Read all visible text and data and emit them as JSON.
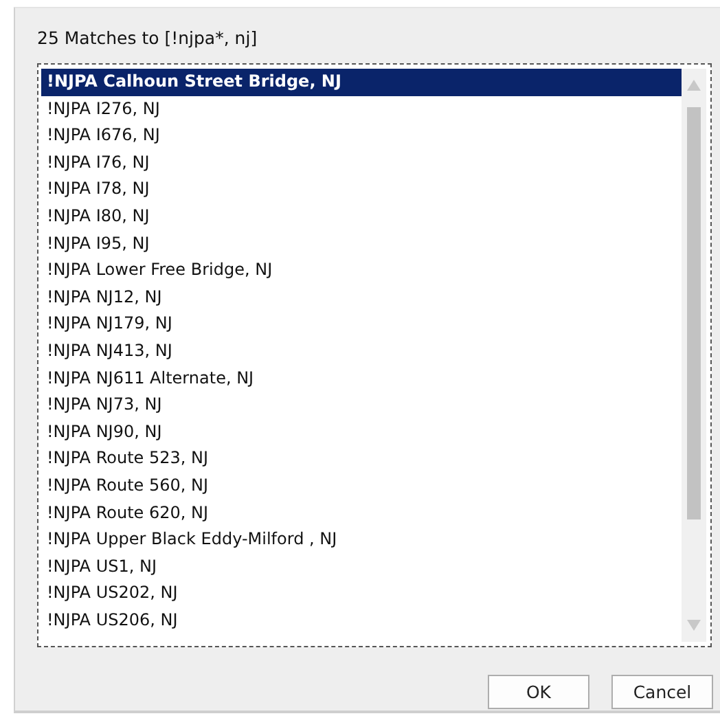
{
  "dialog": {
    "title": "25 Matches to [!njpa*, nj]"
  },
  "list": {
    "items": [
      {
        "label": "!NJPA Calhoun Street Bridge, NJ",
        "selected": true
      },
      {
        "label": "!NJPA I276, NJ",
        "selected": false
      },
      {
        "label": "!NJPA I676, NJ",
        "selected": false
      },
      {
        "label": "!NJPA I76, NJ",
        "selected": false
      },
      {
        "label": "!NJPA I78, NJ",
        "selected": false
      },
      {
        "label": "!NJPA I80, NJ",
        "selected": false
      },
      {
        "label": "!NJPA I95, NJ",
        "selected": false
      },
      {
        "label": "!NJPA Lower Free Bridge, NJ",
        "selected": false
      },
      {
        "label": "!NJPA NJ12, NJ",
        "selected": false
      },
      {
        "label": "!NJPA NJ179, NJ",
        "selected": false
      },
      {
        "label": "!NJPA NJ413, NJ",
        "selected": false
      },
      {
        "label": "!NJPA NJ611 Alternate, NJ",
        "selected": false
      },
      {
        "label": "!NJPA NJ73, NJ",
        "selected": false
      },
      {
        "label": "!NJPA NJ90, NJ",
        "selected": false
      },
      {
        "label": "!NJPA Route 523, NJ",
        "selected": false
      },
      {
        "label": "!NJPA Route 560, NJ",
        "selected": false
      },
      {
        "label": "!NJPA Route 620, NJ",
        "selected": false
      },
      {
        "label": "!NJPA Upper Black Eddy-Milford , NJ",
        "selected": false
      },
      {
        "label": "!NJPA US1, NJ",
        "selected": false
      },
      {
        "label": "!NJPA US202, NJ",
        "selected": false
      },
      {
        "label": "!NJPA US206, NJ",
        "selected": false
      }
    ]
  },
  "buttons": [
    "OK",
    "Cancel"
  ]
}
